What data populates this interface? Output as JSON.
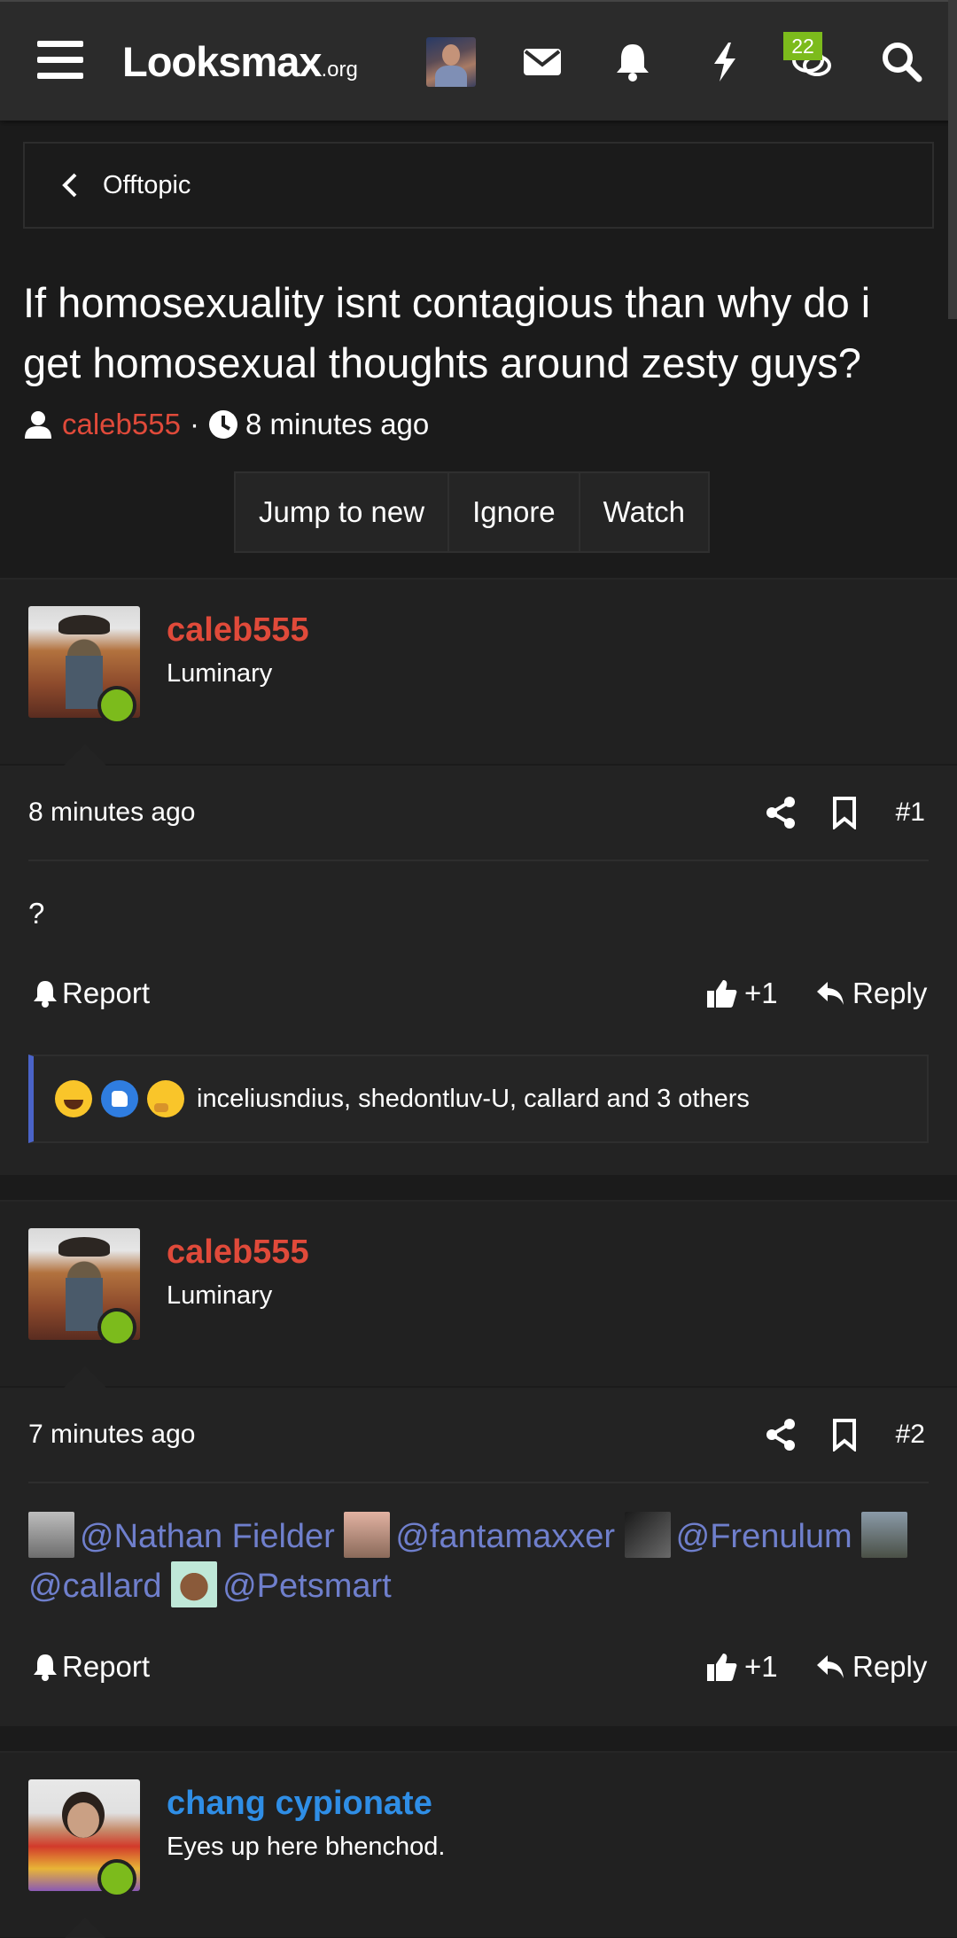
{
  "nav": {
    "logo_main": "Looksmax",
    "logo_suffix": ".org",
    "conversations_badge": "22",
    "colors": {
      "bar": "#2b2b2b",
      "badge": "#7cbb1c"
    },
    "icons": [
      "menu-icon",
      "user-avatar",
      "envelope-icon",
      "bell-icon",
      "lightning-icon",
      "conversations-icon",
      "search-icon"
    ]
  },
  "breadcrumb": {
    "label": "Offtopic"
  },
  "thread": {
    "title": "If homosexuality isnt contagious than why do i get homosexual thoughts around zesty guys?",
    "author": "caleb555",
    "separator": "·",
    "time": "8 minutes ago",
    "actions": [
      "Jump to new",
      "Ignore",
      "Watch"
    ]
  },
  "posts": [
    {
      "username": "caleb555",
      "user_title": "Luminary",
      "time": "8 minutes ago",
      "number": "#1",
      "body": "?",
      "report_label": "Report",
      "like_label": "+1",
      "reply_label": "Reply",
      "reactions_text": "inceliusndius, shedontluv-U, callard and 3 others"
    },
    {
      "username": "caleb555",
      "user_title": "Luminary",
      "time": "7 minutes ago",
      "number": "#2",
      "mentions": [
        "@Nathan Fielder",
        "@fantamaxxer",
        "@Frenulum",
        "@callard",
        "@Petsmart"
      ],
      "report_label": "Report",
      "like_label": "+1",
      "reply_label": "Reply"
    },
    {
      "username": "chang cypionate",
      "user_title": "Eyes up here bhenchod."
    }
  ],
  "colors": {
    "background": "#1b1b1b",
    "username_red": "#e04a3a",
    "username_blue": "#2f8ee6",
    "mention": "#6f7fcc",
    "online": "#7cbb1c",
    "reaction_border": "#4a63c8"
  }
}
